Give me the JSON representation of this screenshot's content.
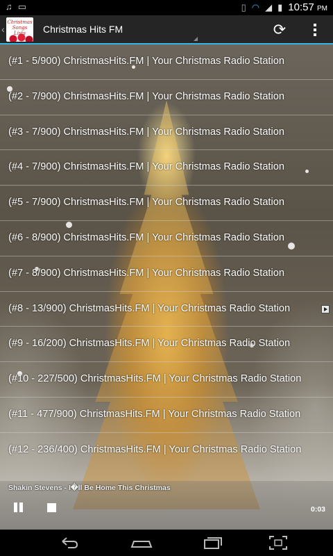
{
  "status_bar": {
    "time": "10:57",
    "ampm": "PM",
    "left_icons": [
      "music-icon",
      "image-icon"
    ],
    "right_icons": [
      "vibrate-icon",
      "wifi-icon",
      "signal-icon",
      "battery-icon"
    ]
  },
  "action_bar": {
    "app_icon_text": "Christmas Songs Lists",
    "title": "Christmas Hits FM",
    "refresh_icon": "refresh-icon",
    "overflow_icon": "overflow-menu-icon"
  },
  "stations": [
    {
      "label": "(#1 - 5/900) ChristmasHits.FM | Your Christmas Radio Station",
      "playing": false
    },
    {
      "label": "(#2 - 7/900) ChristmasHits.FM | Your Christmas Radio Station",
      "playing": false
    },
    {
      "label": "(#3 - 7/900) ChristmasHits.FM | Your Christmas Radio Station",
      "playing": false
    },
    {
      "label": "(#4 - 7/900) ChristmasHits.FM | Your Christmas Radio Station",
      "playing": false
    },
    {
      "label": "(#5 - 7/900) ChristmasHits.FM | Your Christmas Radio Station",
      "playing": false
    },
    {
      "label": "(#6 - 8/900) ChristmasHits.FM | Your Christmas Radio Station",
      "playing": false
    },
    {
      "label": "(#7 - 8/900) ChristmasHits.FM | Your Christmas Radio Station",
      "playing": false
    },
    {
      "label": "(#8 - 13/900) ChristmasHits.FM | Your Christmas Radio Station",
      "playing": true
    },
    {
      "label": "(#9 - 16/200) ChristmasHits.FM | Your Christmas Radio Station",
      "playing": false
    },
    {
      "label": "(#10 - 227/500) ChristmasHits.FM | Your Christmas Radio Station",
      "playing": false
    },
    {
      "label": "(#11 - 477/900) ChristmasHits.FM | Your Christmas Radio Station",
      "playing": false
    },
    {
      "label": "(#12 - 236/400) ChristmasHits.FM | Your Christmas Radio Station",
      "playing": false
    }
  ],
  "player": {
    "track": "Shakin Stevens - I�ll Be Home This Christmas",
    "elapsed": "0:03",
    "pause_icon": "pause-icon",
    "stop_icon": "stop-icon"
  },
  "nav_bar": {
    "buttons": [
      "back-icon",
      "home-icon",
      "recent-apps-icon",
      "screenshot-icon"
    ]
  },
  "colors": {
    "accent": "#33b5e5",
    "action_bar_bg": "#252525",
    "text": "#ffffff"
  }
}
